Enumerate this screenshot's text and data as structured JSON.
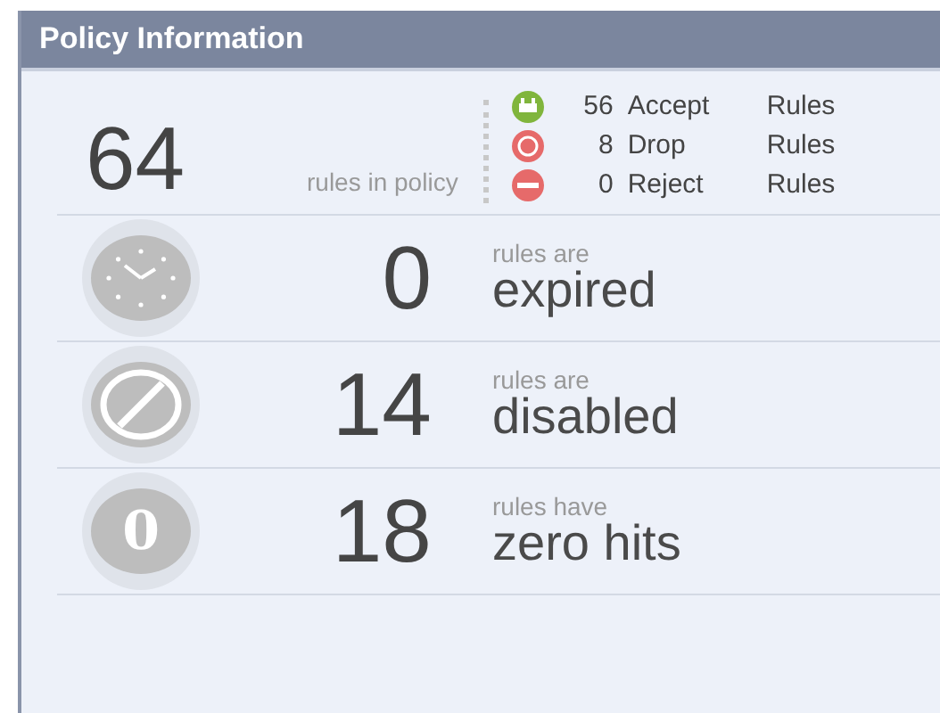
{
  "panel": {
    "title": "Policy Information"
  },
  "summary": {
    "total": "64",
    "label": "rules in policy",
    "breakdown": [
      {
        "kind": "accept",
        "count": "56",
        "type": "Accept",
        "unit": "Rules"
      },
      {
        "kind": "drop",
        "count": "8",
        "type": "Drop",
        "unit": "Rules"
      },
      {
        "kind": "reject",
        "count": "0",
        "type": "Reject",
        "unit": "Rules"
      }
    ]
  },
  "stats": [
    {
      "kind": "expired",
      "count": "0",
      "caption": "rules are",
      "label": "expired"
    },
    {
      "kind": "disabled",
      "count": "14",
      "caption": "rules are",
      "label": "disabled"
    },
    {
      "kind": "zero",
      "icon_text": "0",
      "count": "18",
      "caption": "rules have",
      "label": "zero hits"
    }
  ]
}
